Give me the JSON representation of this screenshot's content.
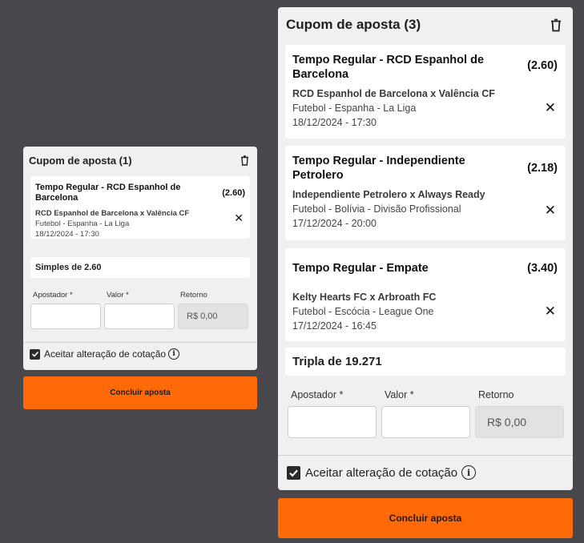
{
  "small": {
    "title": "Cupom de aposta (1)",
    "bets": [
      {
        "title": "Tempo Regular - RCD Espanhol de Barcelona",
        "odds": "(2.60)",
        "match": "RCD Espanhol de Barcelona x Valência CF",
        "league": "Futebol - Espanha - La Liga",
        "datetime": "18/12/2024 - 17:30"
      }
    ],
    "summary": "Simples de 2.60",
    "fields": {
      "bettor": "Apostador *",
      "value": "Valor *",
      "return": "Retorno",
      "return_value": "R$ 0,00"
    },
    "accept": "Aceitar alteração de cotação",
    "cta": "Concluir aposta"
  },
  "large": {
    "title": "Cupom de aposta (3)",
    "bets": [
      {
        "title": "Tempo Regular - RCD Espanhol de Barcelona",
        "odds": "(2.60)",
        "match": "RCD Espanhol de Barcelona x Valência CF",
        "league": "Futebol - Espanha - La Liga",
        "datetime": "18/12/2024 - 17:30"
      },
      {
        "title": "Tempo Regular - Independiente Petrolero",
        "odds": "(2.18)",
        "match": "Independiente Petrolero x Always Ready",
        "league": "Futebol - Bolívia - Divisão Profissional",
        "datetime": "17/12/2024 - 20:00"
      },
      {
        "title": "Tempo Regular - Empate",
        "odds": "(3.40)",
        "match": "Kelty Hearts FC x Arbroath FC",
        "league": "Futebol - Escócia - League One",
        "datetime": "17/12/2024 - 16:45"
      }
    ],
    "summary": "Tripla de 19.271",
    "fields": {
      "bettor": "Apostador *",
      "value": "Valor *",
      "return": "Retorno",
      "return_value": "R$ 0,00"
    },
    "accept": "Aceitar alteração de cotação",
    "cta": "Concluir aposta"
  },
  "icons": {
    "delete": "trash-icon",
    "remove": "close-icon",
    "check": "checkmark-icon",
    "info": "info-icon"
  },
  "colors": {
    "background": "#48474b",
    "panel": "#f0f0f0",
    "accent": "#ff6a08"
  }
}
